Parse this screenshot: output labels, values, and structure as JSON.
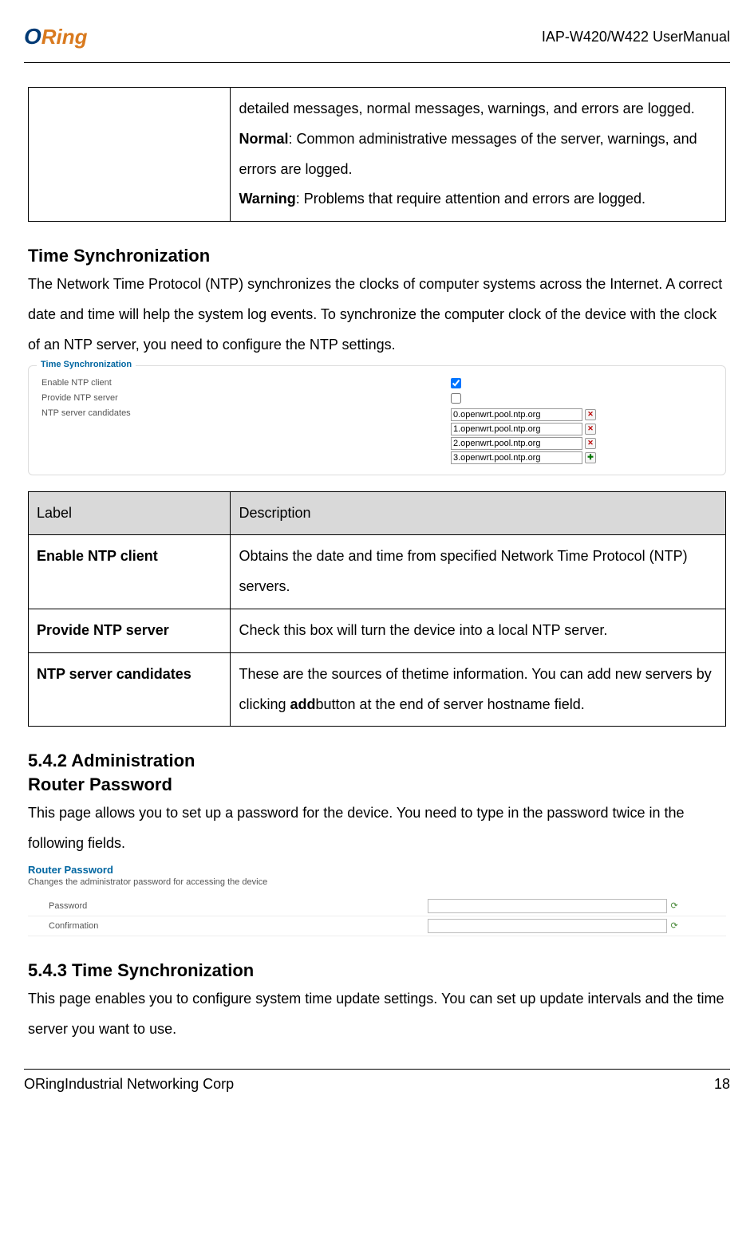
{
  "header": {
    "logo_o": "O",
    "logo_ring": "Ring",
    "doc_title": "IAP-W420/W422  UserManual"
  },
  "top_table_cell": {
    "line1": "detailed messages, normal messages, warnings, and errors are logged.",
    "normal_label": "Normal",
    "normal_text": ": Common administrative messages of the server, warnings, and errors are logged.",
    "warning_label": "Warning",
    "warning_text": ": Problems that require attention and errors are logged."
  },
  "timesync": {
    "heading": "Time Synchronization",
    "para": "The Network Time Protocol (NTP) synchronizes the clocks of computer systems across the Internet. A correct date and time will help the system log events. To synchronize the computer clock of the device with the clock of an NTP server, you need to configure the NTP settings.",
    "fs_legend": "Time Synchronization",
    "row1_label": "Enable NTP client",
    "row1_checked": true,
    "row2_label": "Provide NTP server",
    "row2_checked": false,
    "row3_label": "NTP server candidates",
    "candidates": [
      "0.openwrt.pool.ntp.org",
      "1.openwrt.pool.ntp.org",
      "2.openwrt.pool.ntp.org",
      "3.openwrt.pool.ntp.org"
    ]
  },
  "timesync_table": {
    "hdr_label": "Label",
    "hdr_desc": "Description",
    "r1_label": "Enable NTP client",
    "r1_desc": "Obtains the date and time from specified Network Time Protocol (NTP) servers.",
    "r2_label": "Provide NTP server",
    "r2_desc": "Check this box will turn the device into a local NTP server.",
    "r3_label": "NTP server candidates",
    "r3_desc_a": "These are the sources of thetime information. You can add new servers by clicking ",
    "r3_desc_bold": "add",
    "r3_desc_b": "button at the end of server hostname field."
  },
  "admin": {
    "heading": "5.4.2 Administration",
    "sub": "Router Password",
    "para": "This page allows you to set up a password for the device. You need to type in the password twice in the following fields.",
    "rp_title": "Router Password",
    "rp_sub": "Changes the administrator password for accessing the device",
    "pw_label": "Password",
    "cf_label": "Confirmation"
  },
  "timesync2": {
    "heading": "5.4.3 Time Synchronization",
    "para": "This page enables you to configure system time update settings. You can set up update intervals and the time server you want to use."
  },
  "footer": {
    "company": "ORingIndustrial Networking Corp",
    "page": "18"
  }
}
